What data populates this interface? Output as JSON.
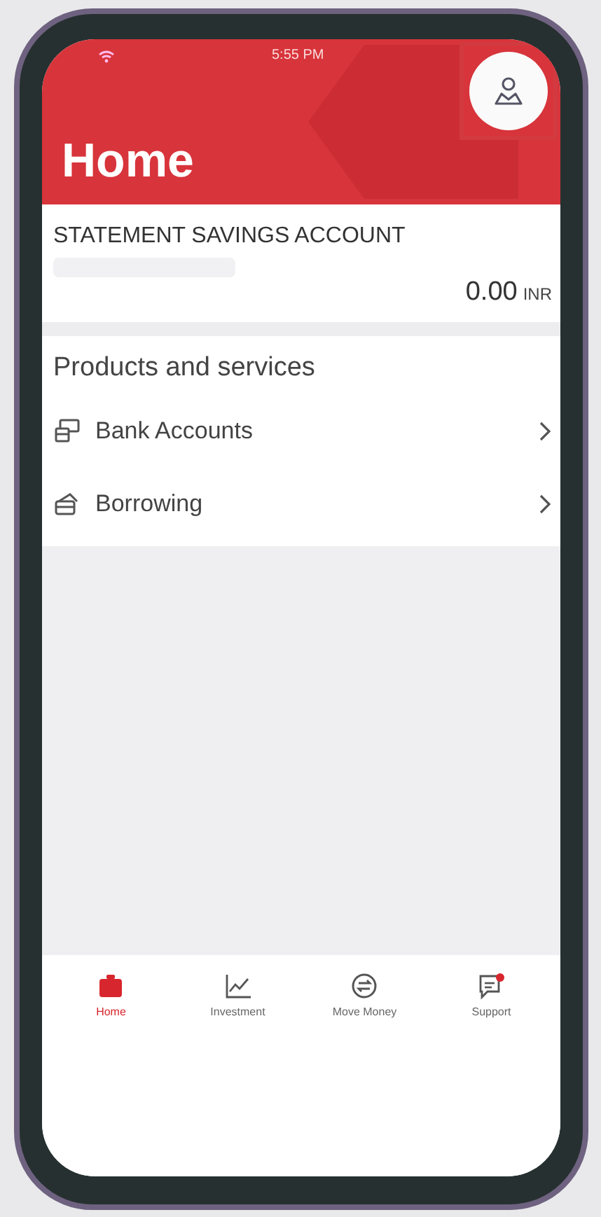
{
  "status_bar": {
    "time": "5:55 PM"
  },
  "header": {
    "title": "Home"
  },
  "account": {
    "name": "STATEMENT SAVINGS ACCOUNT",
    "balance": "0.00",
    "currency": "INR"
  },
  "products": {
    "title": "Products and services",
    "items": [
      {
        "kind": "bank",
        "label": "Bank Accounts"
      },
      {
        "kind": "borrow",
        "label": "Borrowing"
      }
    ]
  },
  "tabs": [
    {
      "kind": "home",
      "label": "Home",
      "selected": true
    },
    {
      "kind": "investment",
      "label": "Investment",
      "selected": false
    },
    {
      "kind": "transfer",
      "label": "Move Money",
      "selected": false
    },
    {
      "kind": "support",
      "label": "Support",
      "selected": false
    }
  ]
}
